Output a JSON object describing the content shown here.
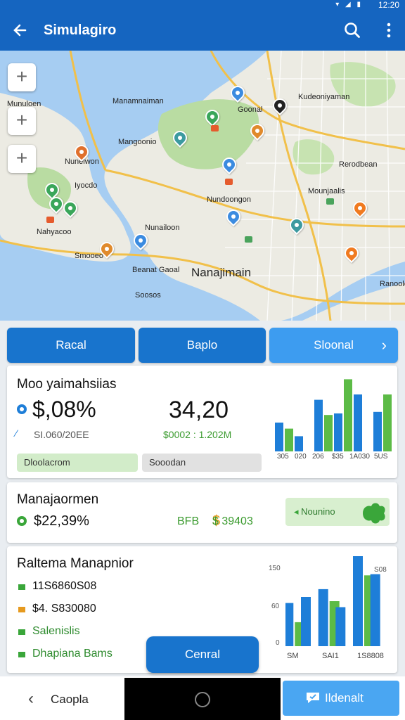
{
  "status": {
    "time": "12:20"
  },
  "appbar": {
    "title": "Simulagiro",
    "back_icon": "arrow-left-icon",
    "search_icon": "search-icon",
    "more_icon": "more-vertical-icon"
  },
  "map": {
    "zoom_buttons": [
      "+",
      "+",
      "+"
    ],
    "labels": {
      "l1": "Goonal",
      "l2": "Manamnaiman",
      "l3": "Mangoonio",
      "l4": "Nunelwon",
      "l5": "Iyocdo",
      "l6": "Rerodbean",
      "l7": "Nahyacoo",
      "l8": "Nunailoon",
      "l9": "Nanajimain",
      "l10": "Beanat Gaoal",
      "l11": "Soosos",
      "l12": "Kudeoniyaman",
      "l13": "Ranoolo",
      "l14": "Mounjaalis",
      "l15": "Nundoongon",
      "l16": "Smooeo",
      "l17": "Munuloen"
    },
    "colors": {
      "water": "#9ec8f0",
      "land": "#ecebe3",
      "park": "#b8dca0",
      "road": "#f4c542"
    }
  },
  "tabs": [
    {
      "label": "Racal"
    },
    {
      "label": "Baplo"
    },
    {
      "label": "Sloonal"
    }
  ],
  "summary": {
    "title": "Moo yaimahsiias",
    "metric1_value": "$,08%",
    "metric1_sub": "SI.060/20EE",
    "metric2_value": "34,20",
    "metric2_sub": "$0002 : 1.202M",
    "pill1": "Dloolacrom",
    "pill2": "Sooodan",
    "x_labels": [
      "305",
      "020",
      "206",
      "$35",
      "1A030",
      "5US"
    ]
  },
  "management": {
    "title": "Manajaormen",
    "value": "$22,39%",
    "col2": "BFB",
    "col3": "$ 39403",
    "badge": "Nounino"
  },
  "report": {
    "title": "Raltema Manapnior",
    "items": [
      "11S6860S08",
      "$4. S830080",
      "Salenislis",
      "Dhapiana Bams"
    ],
    "y_labels": [
      "150",
      "60",
      "0"
    ],
    "x_labels": [
      "SM",
      "SAI1",
      "1S8808"
    ],
    "legend_label": "S08"
  },
  "fab": {
    "label": "Cenral"
  },
  "bottom": {
    "back_label": "Caopla",
    "right_label": "Ildenalt"
  },
  "chart_data": [
    {
      "type": "bar",
      "categories": [
        "305",
        "020",
        "206",
        "$35",
        "1A030",
        "5US"
      ],
      "series": [
        {
          "values": [
            38,
            20,
            68,
            50,
            75,
            52
          ]
        },
        {
          "values": [
            30,
            0,
            48,
            95,
            0,
            75
          ]
        }
      ],
      "colors": [
        "#1e7ed8",
        "#5cbb46"
      ]
    },
    {
      "type": "bar",
      "categories": [
        "SM",
        "SAI1",
        "1S8808"
      ],
      "y_ticks": [
        "150",
        "60",
        "0"
      ],
      "series": [
        {
          "values": [
            72,
            82,
            95,
            65,
            150,
            120
          ]
        },
        {
          "values": [
            40,
            0,
            75,
            0,
            118,
            0
          ]
        }
      ],
      "colors": [
        "#1e7ed8",
        "#5cbb46"
      ]
    }
  ]
}
